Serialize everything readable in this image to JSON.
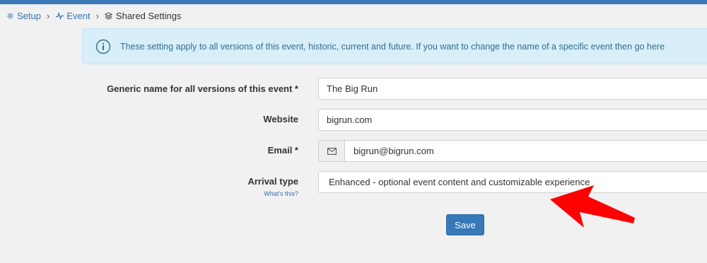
{
  "header": {
    "accent_color": "#3b78b7"
  },
  "breadcrumb": {
    "items": [
      {
        "label": "Setup",
        "icon": "gear-icon"
      },
      {
        "label": "Event",
        "icon": "activity-icon"
      },
      {
        "label": "Shared Settings",
        "icon": "layers-icon"
      }
    ]
  },
  "alert": {
    "icon": "info-icon",
    "text": "These setting apply to all versions of this event, historic, current and future. If you want to change the name of a specific event then go ",
    "link": "here"
  },
  "form": {
    "generic_name": {
      "label": "Generic name for all versions of this event *",
      "value": "The Big Run"
    },
    "website": {
      "label": "Website",
      "value": "bigrun.com"
    },
    "email": {
      "label": "Email *",
      "icon": "envelope-icon",
      "value": "bigrun@bigrun.com"
    },
    "arrival_type": {
      "label": "Arrival type",
      "help_link": "What's this?",
      "value": "Enhanced - optional event content and customizable experience"
    },
    "save_label": "Save"
  },
  "annotation": {
    "icon": "red-arrow",
    "color": "#ff0000"
  }
}
